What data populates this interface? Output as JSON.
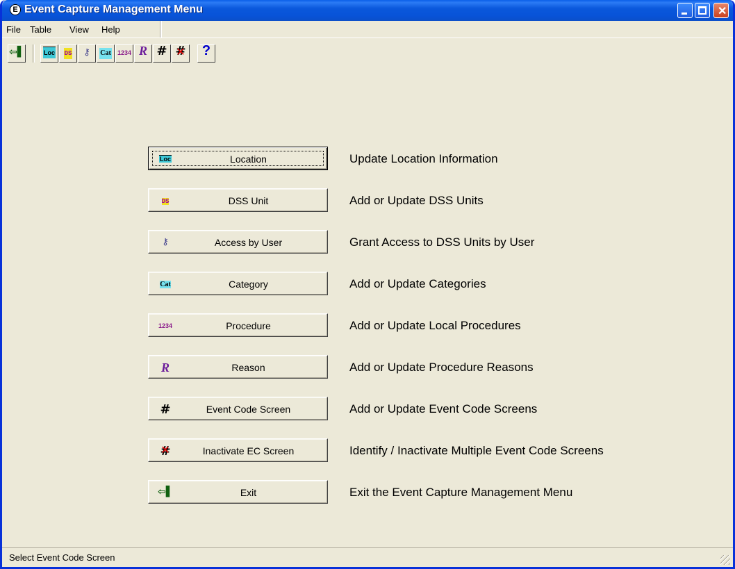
{
  "window": {
    "title": "Event Capture Management Menu",
    "app_icon": "E"
  },
  "menubar": [
    "File",
    "Table",
    "View",
    "Help"
  ],
  "toolbar": {
    "items": [
      {
        "name": "exit",
        "glyph": "⇦▮"
      },
      {
        "name": "location",
        "glyph": "Loc"
      },
      {
        "name": "dss-unit",
        "glyph": "DSS"
      },
      {
        "name": "access-by-user",
        "glyph": "⚷"
      },
      {
        "name": "category",
        "glyph": "Cat"
      },
      {
        "name": "procedure",
        "glyph": "1·2·3·4"
      },
      {
        "name": "reason",
        "glyph": "R"
      },
      {
        "name": "event-code-screen",
        "glyph": "#"
      },
      {
        "name": "inactivate-ec-screen",
        "glyph": "#"
      },
      {
        "name": "help",
        "glyph": "?"
      }
    ]
  },
  "buttons": [
    {
      "key": "location",
      "label": "Location",
      "desc": "Update Location Information",
      "icon": "loc-icon",
      "focused": true
    },
    {
      "key": "dss-unit",
      "label": "DSS Unit",
      "desc": "Add or Update DSS Units",
      "icon": "dss-icon"
    },
    {
      "key": "access-by-user",
      "label": "Access by User",
      "desc": "Grant Access to DSS Units by User",
      "icon": "user-key-icon"
    },
    {
      "key": "category",
      "label": "Category",
      "desc": "Add or Update Categories",
      "icon": "cat-icon"
    },
    {
      "key": "procedure",
      "label": "Procedure",
      "desc": "Add or Update Local Procedures",
      "icon": "procedure-icon"
    },
    {
      "key": "reason",
      "label": "Reason",
      "desc": "Add or Update Procedure Reasons",
      "icon": "reason-icon"
    },
    {
      "key": "event-code-screen",
      "label": "Event Code Screen",
      "desc": "Add or Update Event Code Screens",
      "icon": "grid-icon"
    },
    {
      "key": "inactivate-ec-screen",
      "label": "Inactivate EC Screen",
      "desc": "Identify / Inactivate Multiple Event Code Screens",
      "icon": "inactivate-grid-icon"
    },
    {
      "key": "exit",
      "label": "Exit",
      "desc": "Exit the Event Capture Management Menu",
      "icon": "exit-icon"
    }
  ],
  "statusbar": {
    "text": "Select Event Code Screen"
  }
}
